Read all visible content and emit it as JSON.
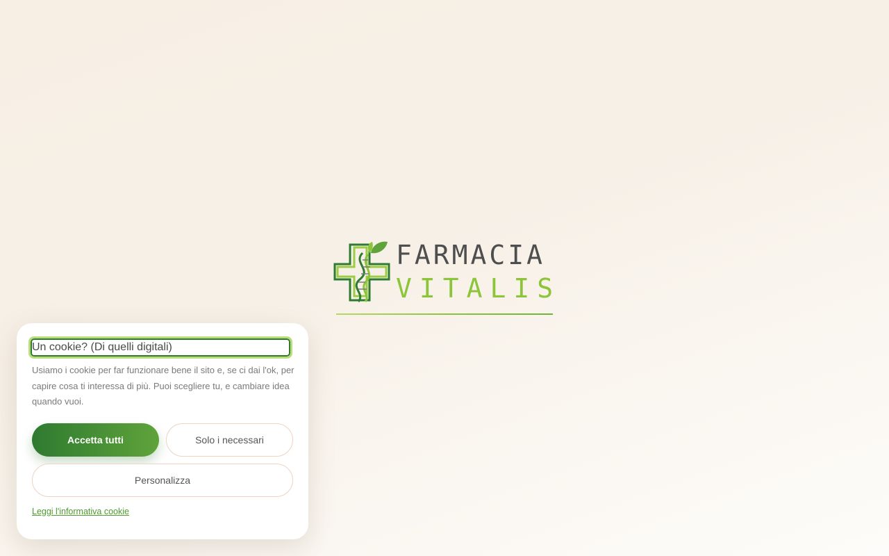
{
  "brand": {
    "logo_line1": "FARMACIA",
    "logo_line2": "VITALIS",
    "logo_icon": "cross-dna-leaf-icon",
    "colors": {
      "green_dark": "#2e7a30",
      "green_light": "#8cc43a",
      "gray_text": "#4e4e4e"
    }
  },
  "cookie_banner": {
    "title": "Un cookie? (Di quelli digitali)",
    "body": "Usiamo i cookie per far funzionare bene il sito e, se ci dai l'ok, per capire cosa ti interessa di più. Puoi scegliere tu, e cambiare idea quando vuoi.",
    "accept_all_label": "Accetta tutti",
    "necessary_only_label": "Solo i necessari",
    "customize_label": "Personalizza",
    "policy_link_label": "Leggi l'informativa cookie"
  }
}
